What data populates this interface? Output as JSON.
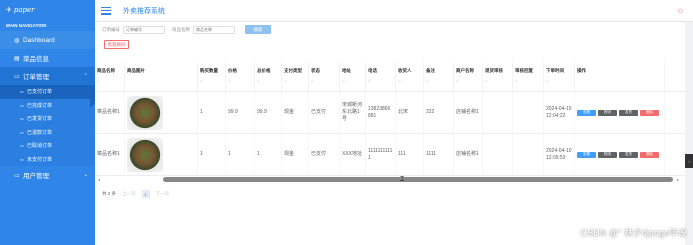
{
  "sidebar": {
    "logo": "paper",
    "nav_title": "MAIN NAVIGATION",
    "items": [
      {
        "label": "Dashboard",
        "icon": "dashboard-icon"
      },
      {
        "label": "菜品信息",
        "icon": "food-icon"
      },
      {
        "label": "订单管理",
        "icon": "order-icon"
      },
      {
        "label": "用户管理",
        "icon": "user-icon"
      }
    ],
    "submenu": [
      {
        "label": "已支付订单"
      },
      {
        "label": "已完成订单"
      },
      {
        "label": "已发货订单"
      },
      {
        "label": "已退款订单"
      },
      {
        "label": "已取消订单"
      },
      {
        "label": "未支付订单"
      }
    ]
  },
  "header": {
    "title": "外卖推荐系统"
  },
  "search": {
    "field1_label": "订单编号",
    "field1_placeholder": "订单编号",
    "field2_label": "商品名称",
    "field2_placeholder": "商品名称",
    "search_button": "搜索",
    "batch_delete": "批量删除"
  },
  "table": {
    "columns": [
      "商品名称",
      "商品图片",
      "购买数量",
      "价格",
      "总价格",
      "支付类型",
      "状态",
      "地址",
      "电话",
      "收货人",
      "备注",
      "商户名称",
      "退货审核",
      "审核回复",
      "下单时间",
      "操作"
    ],
    "sort_symbol": "◇",
    "rows": [
      {
        "name": "菜品名称1",
        "qty": "1",
        "price": "99.9",
        "total": "99.9",
        "pay": "现金",
        "status": "已支付",
        "address": "宋城新河东北路1号",
        "phone": "13823866881",
        "receiver": "北宋",
        "remark": "222",
        "merchant": "店铺名称1",
        "return_review": "",
        "review_reply": "",
        "time": "2024-04-10 12:04:22"
      },
      {
        "name": "菜品名称1",
        "qty": "1",
        "price": "1",
        "total": "1",
        "pay": "现金",
        "status": "已支付",
        "address": "XXX地址",
        "phone": "11111111111",
        "receiver": "111",
        "remark": "1111",
        "merchant": "店铺名称1",
        "return_review": "",
        "review_reply": "",
        "time": "2024-04-10 12:05:53"
      }
    ],
    "ops": [
      "查看",
      "物流",
      "发货",
      "删除"
    ]
  },
  "pager": {
    "total": "共 2 条",
    "prev": "上一页",
    "page": "1",
    "next": "下一页"
  },
  "watermark": "CSDN @° 林夕django毕设",
  "colors": {
    "accent": "#2f86e8",
    "danger": "#f56c6c",
    "primary": "#409eff"
  }
}
